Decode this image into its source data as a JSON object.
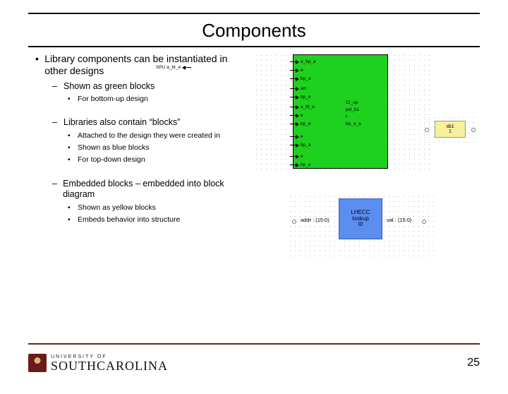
{
  "title": "Components",
  "bullets": {
    "main": "Library components can be instantiated in other designs",
    "sub1": "Shown as green blocks",
    "sub1_1": "For bottom-up design",
    "sub2": "Libraries also contain “blocks”",
    "sub2_1": "Attached to the design they were created in",
    "sub2_2": "Shown as blue blocks",
    "sub2_3": "For top-down design",
    "sub3": "Embedded blocks – embedded into block diagram",
    "sub3_1": "Shown as yellow blocks",
    "sub3_2": "Embeds behavior into structure"
  },
  "green_component": {
    "left_pins": [
      "a_bp_e",
      "e",
      "bp_a",
      "art :",
      "bp_e",
      "a_bt_e",
      "e",
      "bp_e",
      "e",
      "bp_a",
      "e",
      "bp_e"
    ],
    "right_pin": "SPU a_bt_e",
    "inside_labels": [
      "Ct_up",
      "pcl_b1",
      "t",
      "bp_a_e"
    ]
  },
  "yellow_component": {
    "line1": "sb1",
    "line2": "1"
  },
  "blue_component": {
    "line1": "LHECC",
    "line2": "lookup",
    "line3": "I0",
    "left_port": "addr : (15:0)",
    "right_port": "val : (15:0)"
  },
  "footer": {
    "univ_line1": "UNIVERSITY OF",
    "univ_line2": "SOUTHCAROLINA",
    "page": "25"
  }
}
